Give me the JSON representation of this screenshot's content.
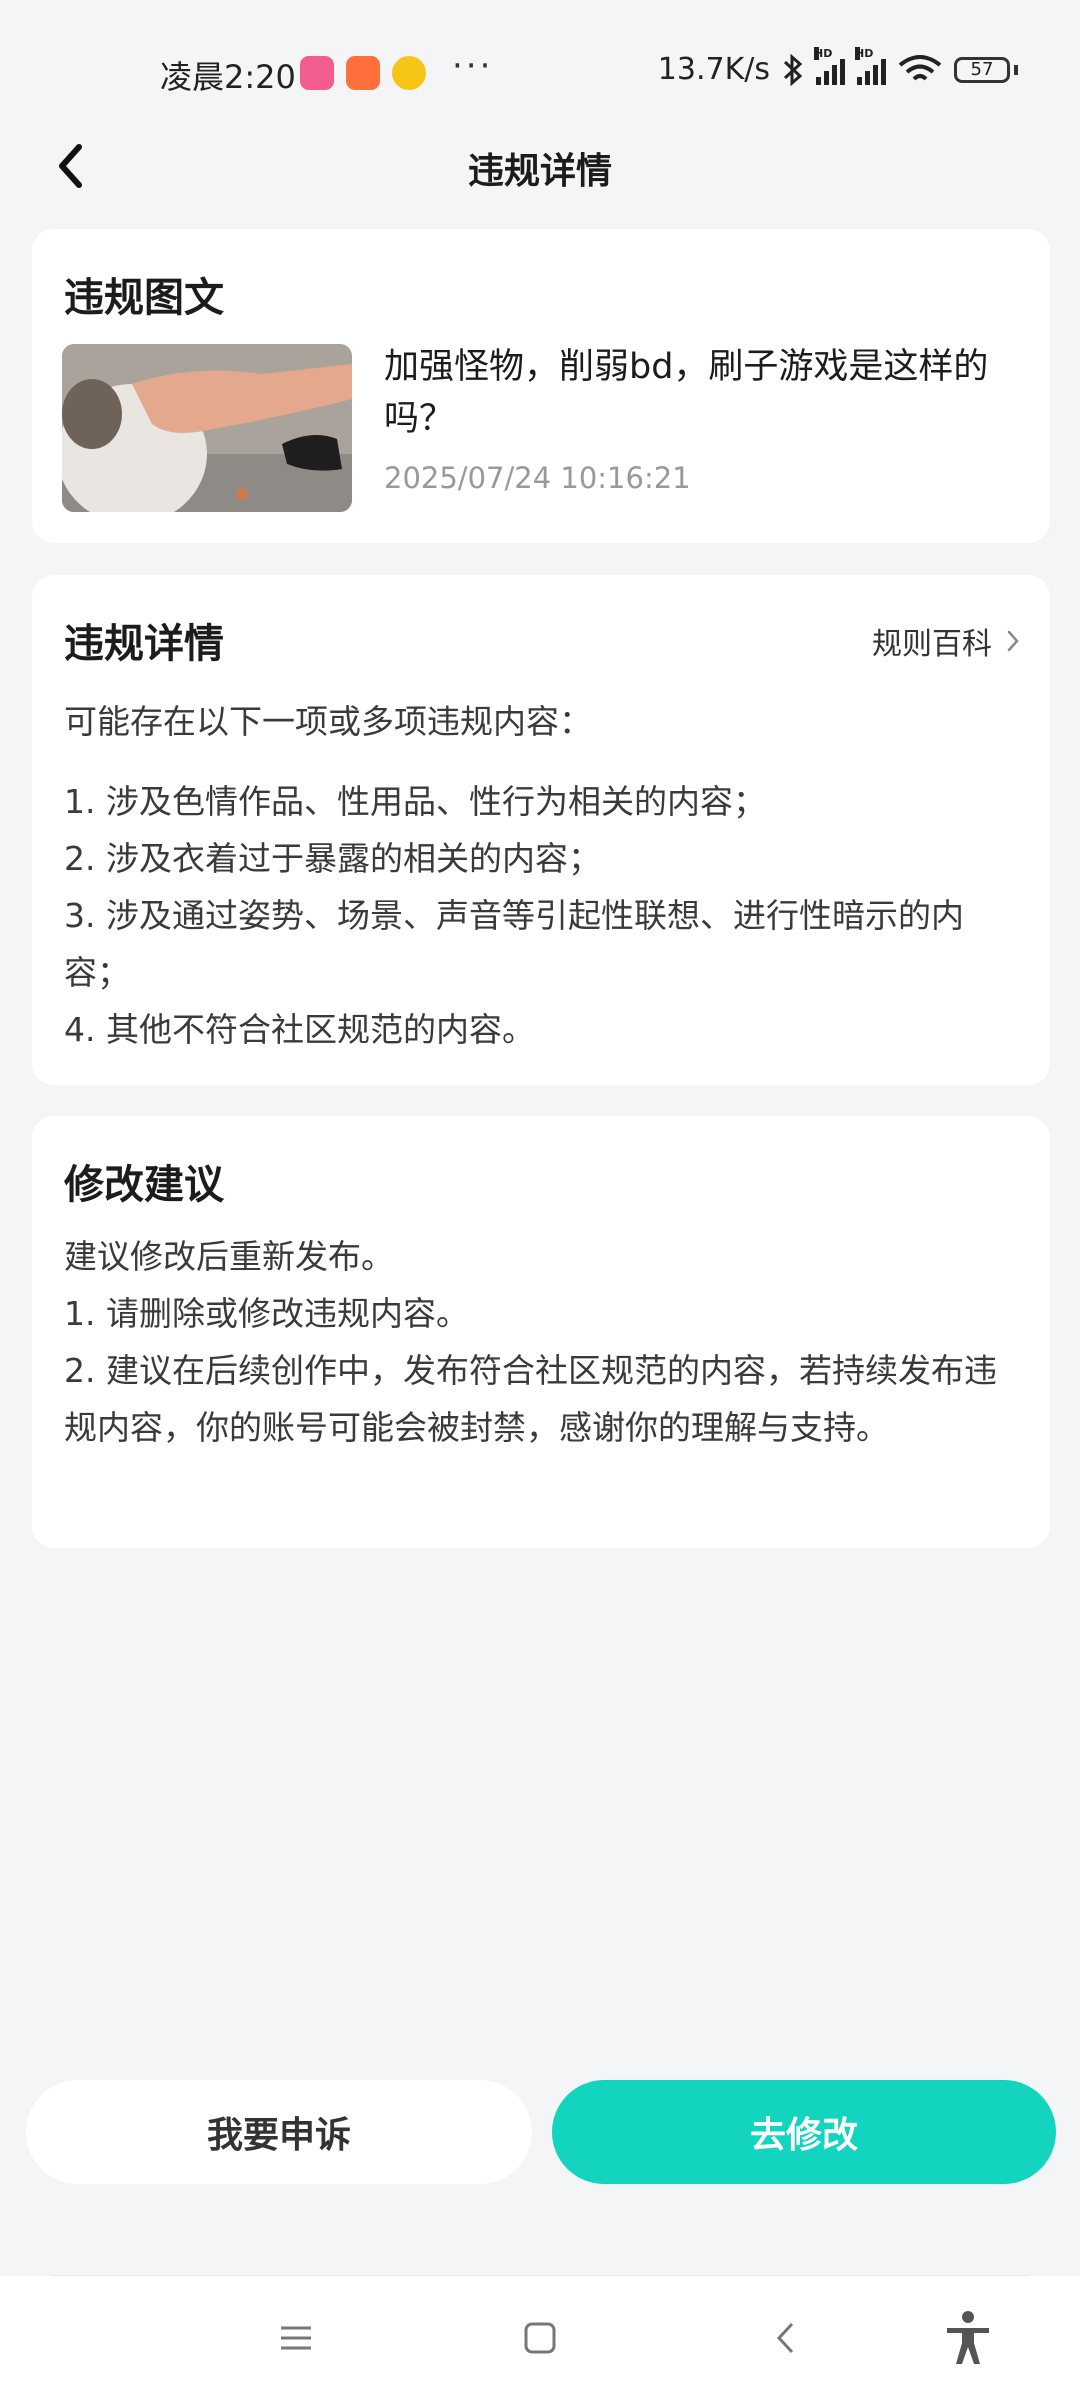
{
  "status_bar": {
    "time": "凌晨2:20",
    "more": "···",
    "net_speed": "13.7K/s",
    "hd1": "HD",
    "hd2": "HD",
    "battery": "57"
  },
  "header": {
    "title": "违规详情"
  },
  "post_card": {
    "title": "违规图文",
    "post_title": "加强怪物，削弱bd，刷子游戏是这样的吗？",
    "post_time": "2025/07/24 10:16:21"
  },
  "detail_card": {
    "title": "违规详情",
    "rules_link": "规则百科",
    "intro": "可能存在以下一项或多项违规内容：",
    "items": [
      "1. 涉及色情作品、性用品、性行为相关的内容；",
      "2. 涉及衣着过于暴露的相关的内容；",
      "3. 涉及通过姿势、场景、声音等引起性联想、进行性暗示的内容；",
      "4. 其他不符合社区规范的内容。"
    ]
  },
  "suggestion_card": {
    "title": "修改建议",
    "lines": [
      "建议修改后重新发布。",
      "1. 请删除或修改违规内容。",
      "2. 建议在后续创作中，发布符合社区规范的内容，若持续发布违规内容，你的账号可能会被封禁，感谢你的理解与支持。"
    ]
  },
  "actions": {
    "appeal": "我要申诉",
    "modify": "去修改"
  },
  "colors": {
    "accent": "#13d4bf",
    "background": "#f4f5f7"
  }
}
